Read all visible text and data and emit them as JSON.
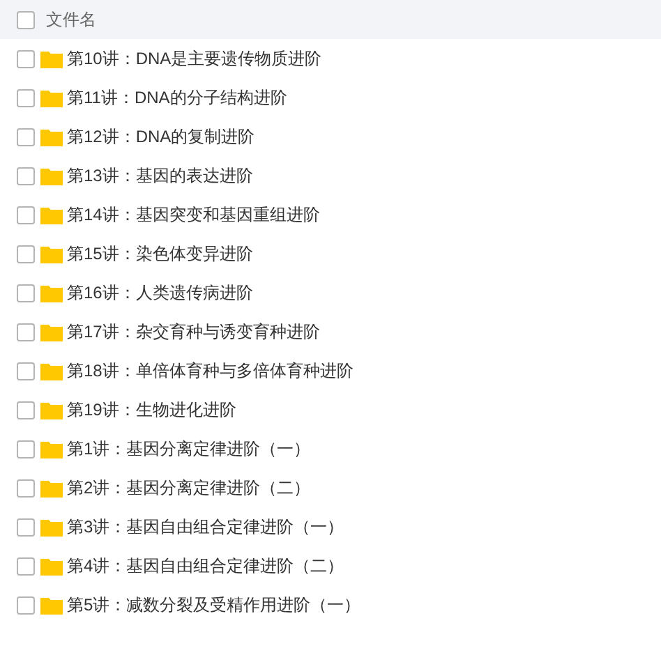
{
  "header": {
    "label": "文件名",
    "checked": false
  },
  "files": [
    {
      "name": "第10讲：DNA是主要遗传物质进阶",
      "checked": false
    },
    {
      "name": "第11讲：DNA的分子结构进阶",
      "checked": false
    },
    {
      "name": "第12讲：DNA的复制进阶",
      "checked": false
    },
    {
      "name": "第13讲：基因的表达进阶",
      "checked": false
    },
    {
      "name": "第14讲：基因突变和基因重组进阶",
      "checked": false
    },
    {
      "name": "第15讲：染色体变异进阶",
      "checked": false
    },
    {
      "name": "第16讲：人类遗传病进阶",
      "checked": false
    },
    {
      "name": "第17讲：杂交育种与诱变育种进阶",
      "checked": false
    },
    {
      "name": "第18讲：单倍体育种与多倍体育种进阶",
      "checked": false
    },
    {
      "name": "第19讲：生物进化进阶",
      "checked": false
    },
    {
      "name": "第1讲：基因分离定律进阶（一）",
      "checked": false
    },
    {
      "name": "第2讲：基因分离定律进阶（二）",
      "checked": false
    },
    {
      "name": "第3讲：基因自由组合定律进阶（一）",
      "checked": false
    },
    {
      "name": "第4讲：基因自由组合定律进阶（二）",
      "checked": false
    },
    {
      "name": "第5讲：减数分裂及受精作用进阶（一）",
      "checked": false
    }
  ]
}
